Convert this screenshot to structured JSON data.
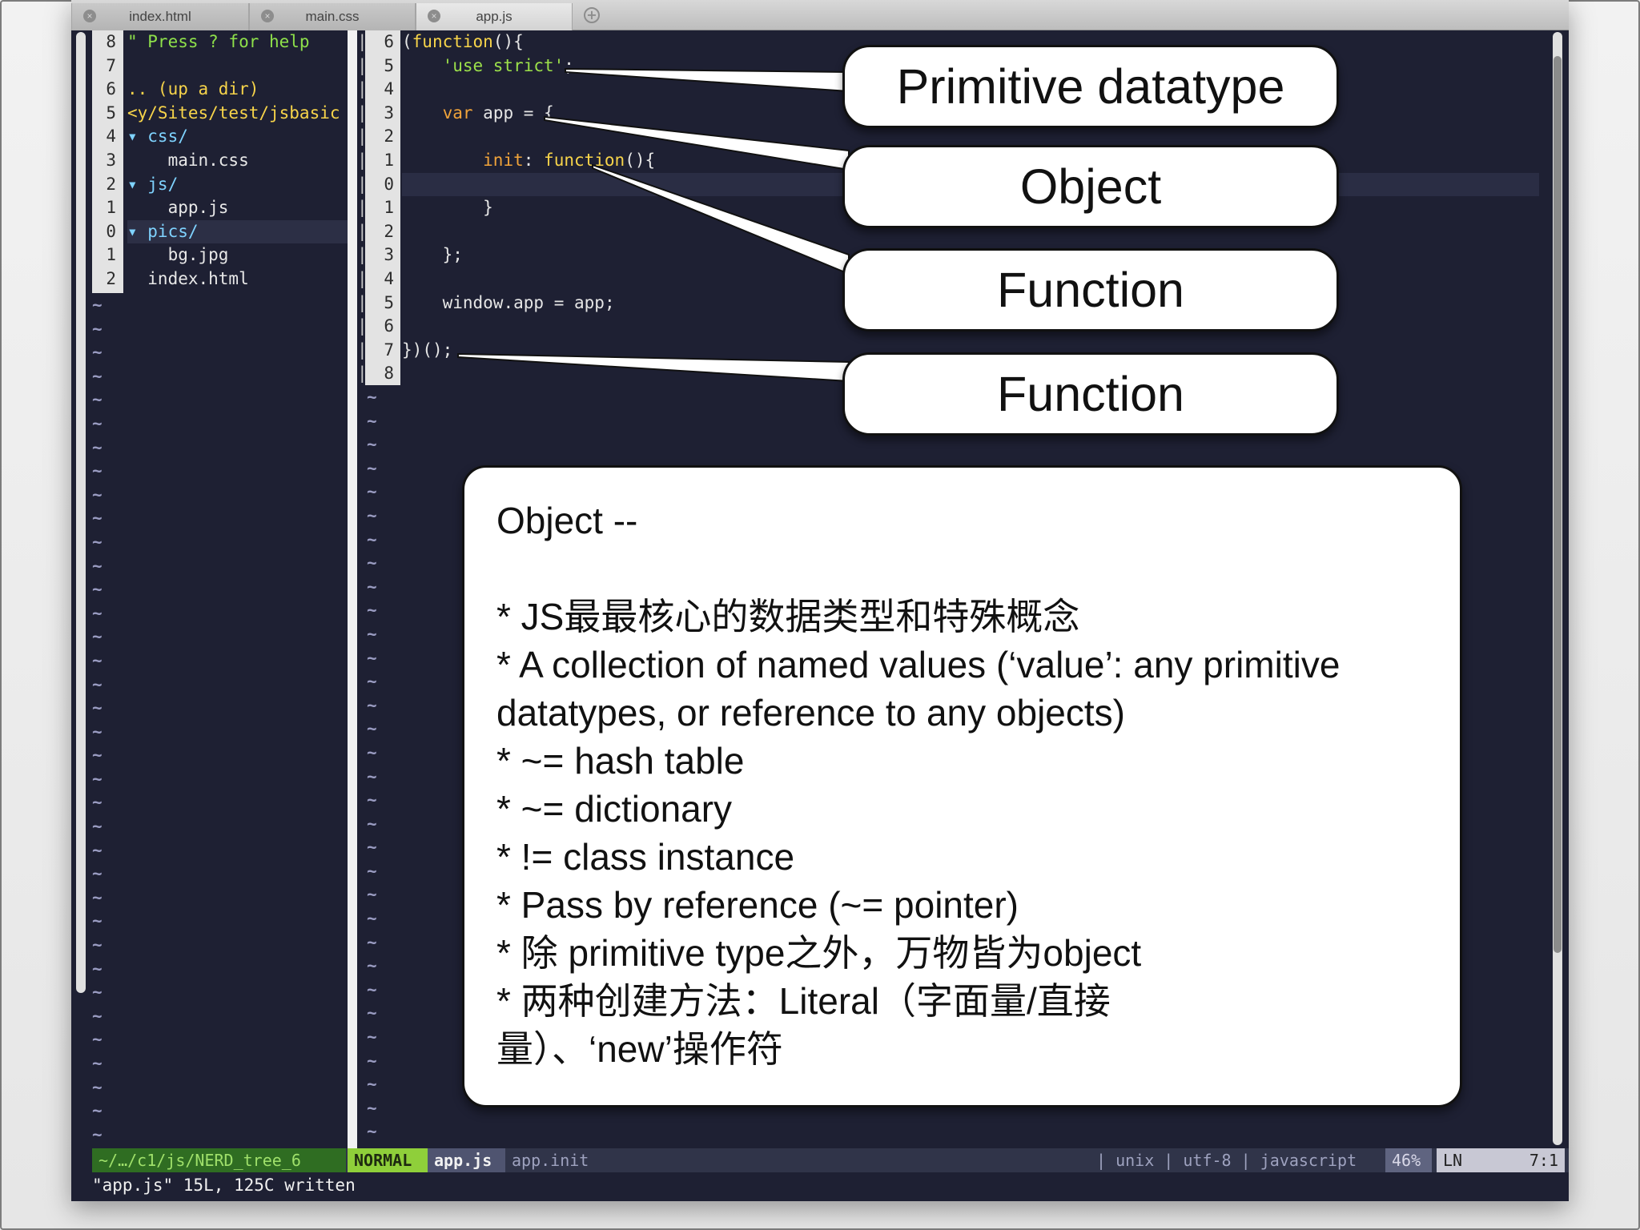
{
  "tabs": [
    {
      "label": "index.html",
      "active": false
    },
    {
      "label": "main.css",
      "active": false
    },
    {
      "label": "app.js",
      "active": true
    }
  ],
  "tree": {
    "gutter": [
      "8",
      "7",
      "6",
      "5",
      "4",
      "3",
      "2",
      "1",
      "0",
      "1",
      "2"
    ],
    "lines": [
      {
        "text": "\" Press ? for help",
        "style": "green"
      },
      {
        "text": "",
        "style": ""
      },
      {
        "text": ".. (up a dir)",
        "style": "yellow"
      },
      {
        "text": "<y/Sites/test/jsbasic",
        "style": "yellow"
      },
      {
        "text": "▾ css/",
        "style": "dir"
      },
      {
        "text": "    main.css",
        "style": ""
      },
      {
        "text": "▾ js/",
        "style": "dir"
      },
      {
        "text": "    app.js",
        "style": ""
      },
      {
        "text": "▾ pics/",
        "style": "dir"
      },
      {
        "text": "    bg.jpg",
        "style": ""
      },
      {
        "text": "  index.html",
        "style": ""
      }
    ]
  },
  "code": {
    "gutter": [
      "6",
      "5",
      "4",
      "3",
      "2",
      "1",
      "0",
      "1",
      "2",
      "3",
      "4",
      "5",
      "6",
      "7",
      "8"
    ],
    "lines": [
      "(function(){",
      "    'use strict';",
      "",
      "    var app = {",
      "",
      "        init: function(){",
      "",
      "        }",
      "",
      "    };",
      "",
      "    window.app = app;",
      "",
      "})();",
      ""
    ]
  },
  "status": {
    "path": "~/…/c1/js/NERD_tree_6",
    "mode": "NORMAL",
    "file": "app.js",
    "func": "app.init",
    "right": "| unix | utf-8 | javascript",
    "percent": "46%",
    "ln_label": "LN",
    "position": "7:1"
  },
  "cmdline": "\"app.js\" 15L, 125C written",
  "callouts": [
    "Primitive datatype",
    "Object",
    "Function",
    "Function"
  ],
  "notes": {
    "title": "Object --",
    "lines": [
      "* JS最最核心的数据类型和特殊概念",
      "* A collection of named values (‘value’: any primitive datatypes, or reference to any objects)",
      "* ~= hash table",
      "* ~= dictionary",
      "* != class instance",
      "* Pass by reference (~= pointer)",
      "* 除 primitive type之外，万物皆为object",
      "* 两种创建方法：Literal（字面量/直接量）、‘new’操作符"
    ]
  }
}
